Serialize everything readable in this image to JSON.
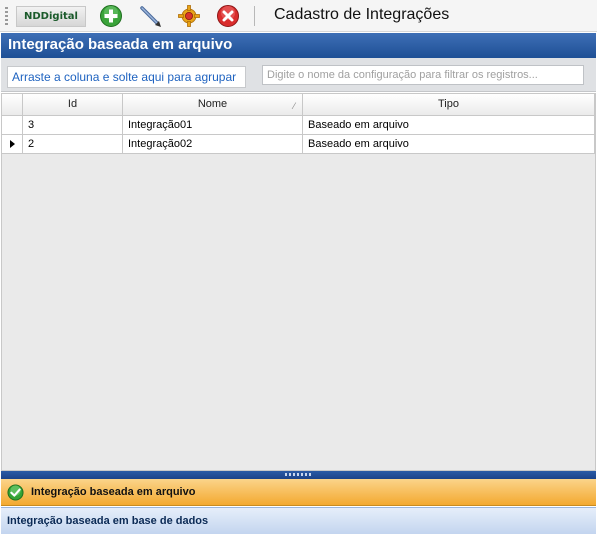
{
  "toolbar": {
    "brand": "NDDigital",
    "title": "Cadastro de Integrações",
    "buttons": [
      {
        "icon": "add-icon",
        "color": "#3aa33a"
      },
      {
        "icon": "edit-pencil-icon",
        "color": "#5a78a8"
      },
      {
        "icon": "gear-icon",
        "color": "#e8b020"
      },
      {
        "icon": "delete-icon",
        "color": "#d92c2c"
      }
    ]
  },
  "section": {
    "title": "Integração baseada em arquivo"
  },
  "group_panel": {
    "hint": "Arraste a coluna e solte aqui para agrupar",
    "filter_placeholder": "Digite o nome da configuração para filtrar os registros..."
  },
  "grid": {
    "columns": [
      "Id",
      "Nome",
      "Tipo"
    ],
    "rows": [
      {
        "id": "3",
        "nome": "Integração01",
        "tipo": "Baseado em arquivo",
        "current": false
      },
      {
        "id": "2",
        "nome": "Integração02",
        "tipo": "Baseado em arquivo",
        "current": true
      }
    ]
  },
  "nav": {
    "active": "Integração baseada em arquivo",
    "other": "Integração baseada em base de dados"
  },
  "colors": {
    "header_blue": "#1e4f95",
    "nav_active_orange": "#f3a930",
    "hint_link_blue": "#1f63c0"
  }
}
